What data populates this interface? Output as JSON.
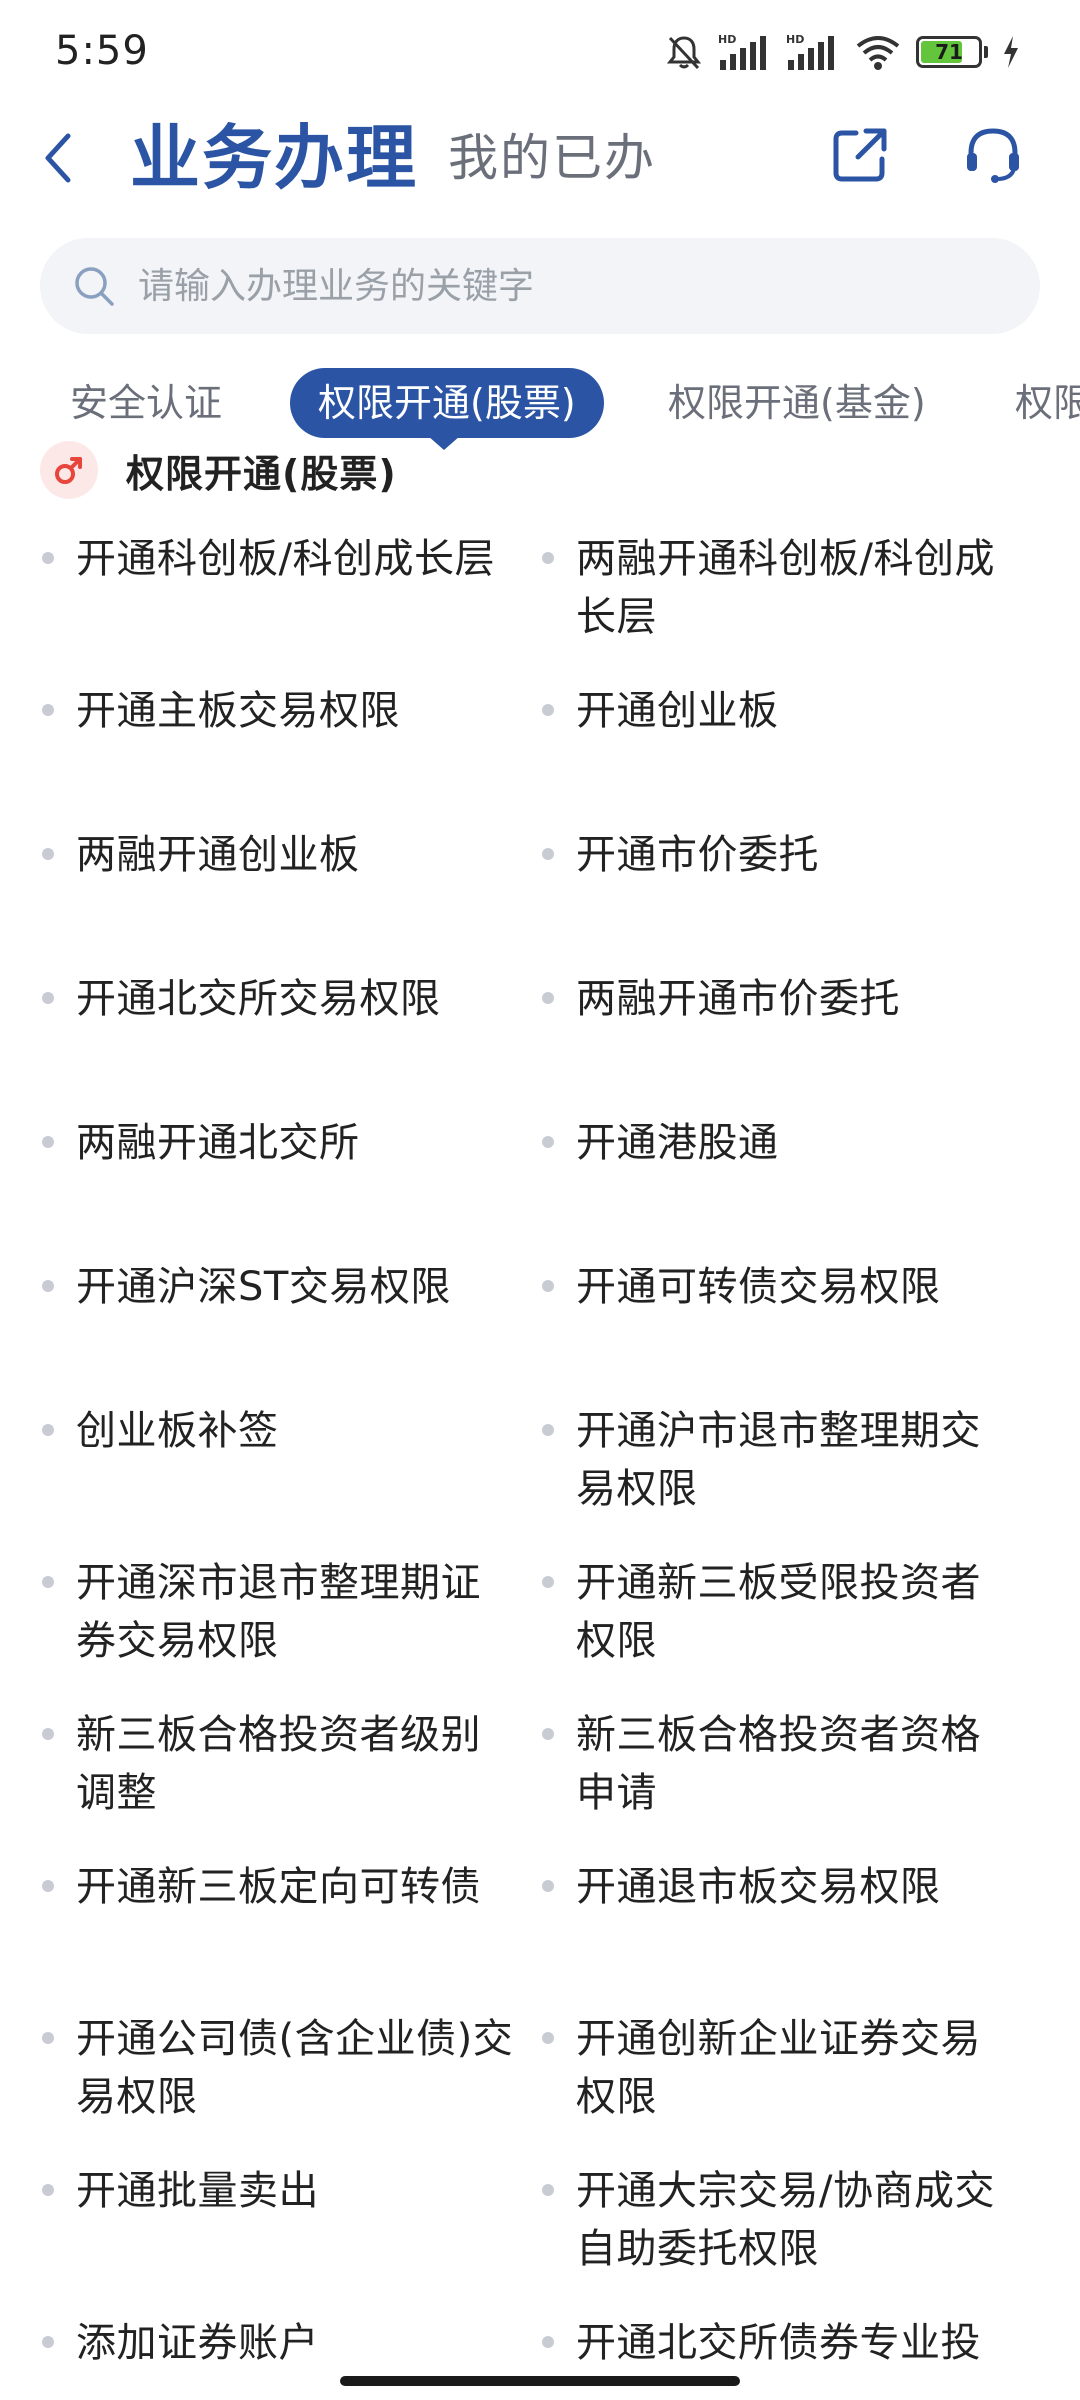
{
  "status_bar": {
    "time": "5:59",
    "battery": "71"
  },
  "header": {
    "title": "业务办理",
    "subtitle": "我的已办"
  },
  "search": {
    "placeholder": "请输入办理业务的关键字"
  },
  "tabs": [
    {
      "label": "安全认证",
      "active": false
    },
    {
      "label": "权限开通(股票)",
      "active": true
    },
    {
      "label": "权限开通(基金)",
      "active": false
    },
    {
      "label": "权限",
      "active": false
    }
  ],
  "section": {
    "title": "权限开通(股票)"
  },
  "items": [
    "开通科创板/科创成长层",
    "两融开通科创板/科创成长层",
    "开通主板交易权限",
    "开通创业板",
    "两融开通创业板",
    "开通市价委托",
    "开通北交所交易权限",
    "两融开通市价委托",
    "两融开通北交所",
    "开通港股通",
    "开通沪深ST交易权限",
    "开通可转债交易权限",
    "创业板补签",
    "开通沪市退市整理期交易权限",
    "开通深市退市整理期证券交易权限",
    "开通新三板受限投资者权限",
    "新三板合格投资者级别调整",
    "新三板合格投资者资格申请",
    "开通新三板定向可转债",
    "开通退市板交易权限",
    "开通公司债(含企业债)交易权限",
    "开通创新企业证券交易权限",
    "开通批量卖出",
    "开通大宗交易/协商成交自助委托权限",
    "添加证券账户",
    "开通北交所债券专业投"
  ],
  "colors": {
    "accent": "#2b55a4",
    "muted": "#6a6f7a",
    "dot": "#c8ccd2",
    "search_bg": "#f2f4f7",
    "section_icon": "#e8453c"
  },
  "icons": {
    "back": "chevron-left-icon",
    "share": "share-external-icon",
    "support": "headset-icon",
    "search": "search-icon",
    "section": "male-symbol-icon"
  }
}
